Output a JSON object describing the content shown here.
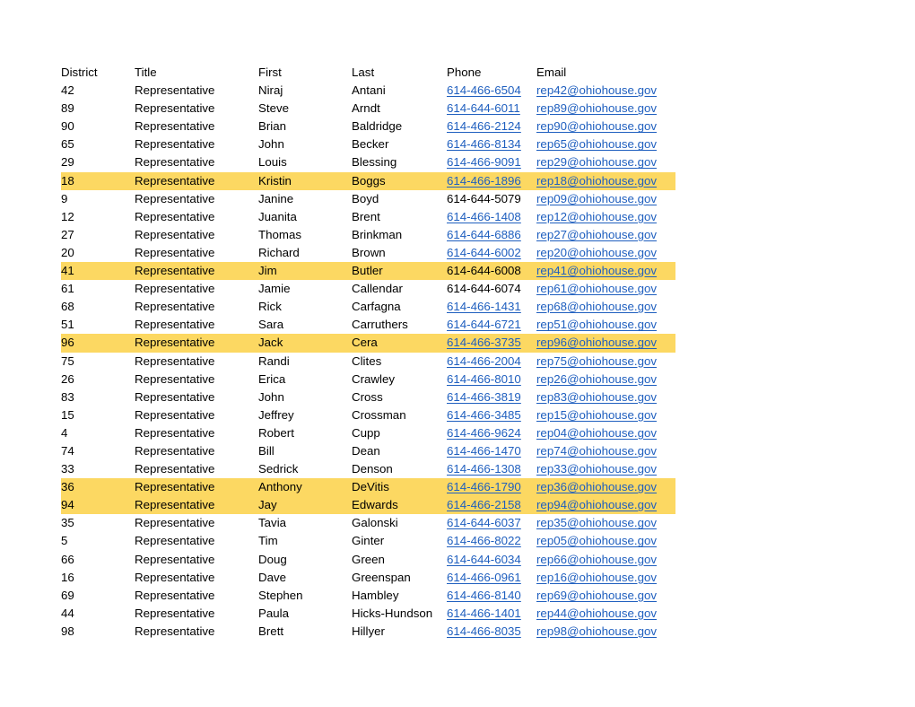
{
  "sheet": {
    "columns": [
      {
        "key": "district",
        "label": "District"
      },
      {
        "key": "title",
        "label": "Title"
      },
      {
        "key": "first",
        "label": "First"
      },
      {
        "key": "last",
        "label": "Last"
      },
      {
        "key": "phone",
        "label": "Phone"
      },
      {
        "key": "email",
        "label": "Email"
      }
    ],
    "highlight_color": "#FCD862",
    "link_color": "#1F5FBF",
    "text_color": "#000000",
    "rows": [
      {
        "district": "42",
        "title": "Representative",
        "first": "Niraj",
        "last": "Antani",
        "phone": "614-466-6504",
        "phone_link": true,
        "email": "rep42@ohiohouse.gov",
        "email_link": true,
        "highlighted": false
      },
      {
        "district": "89",
        "title": "Representative",
        "first": "Steve",
        "last": "Arndt",
        "phone": "614-644-6011",
        "phone_link": true,
        "email": "rep89@ohiohouse.gov",
        "email_link": true,
        "highlighted": false
      },
      {
        "district": "90",
        "title": "Representative",
        "first": "Brian",
        "last": "Baldridge",
        "phone": "614-466-2124",
        "phone_link": true,
        "email": "rep90@ohiohouse.gov",
        "email_link": true,
        "highlighted": false
      },
      {
        "district": "65",
        "title": "Representative",
        "first": "John",
        "last": "Becker",
        "phone": "614-466-8134",
        "phone_link": true,
        "email": "rep65@ohiohouse.gov",
        "email_link": true,
        "highlighted": false
      },
      {
        "district": "29",
        "title": "Representative",
        "first": "Louis",
        "last": "Blessing",
        "phone": "614-466-9091",
        "phone_link": true,
        "email": "rep29@ohiohouse.gov",
        "email_link": true,
        "highlighted": false
      },
      {
        "district": "18",
        "title": "Representative",
        "first": "Kristin",
        "last": "Boggs",
        "phone": "614-466-1896",
        "phone_link": true,
        "email": "rep18@ohiohouse.gov",
        "email_link": true,
        "highlighted": true
      },
      {
        "district": "9",
        "title": "Representative",
        "first": "Janine",
        "last": "Boyd",
        "phone": "614-644-5079",
        "phone_link": false,
        "email": "rep09@ohiohouse.gov",
        "email_link": true,
        "highlighted": false
      },
      {
        "district": "12",
        "title": "Representative",
        "first": "Juanita",
        "last": "Brent",
        "phone": "614-466-1408",
        "phone_link": true,
        "email": "rep12@ohiohouse.gov",
        "email_link": true,
        "highlighted": false
      },
      {
        "district": "27",
        "title": "Representative",
        "first": "Thomas",
        "last": "Brinkman",
        "phone": "614-644-6886",
        "phone_link": true,
        "email": "rep27@ohiohouse.gov",
        "email_link": true,
        "highlighted": false
      },
      {
        "district": "20",
        "title": "Representative",
        "first": "Richard",
        "last": "Brown",
        "phone": "614-644-6002",
        "phone_link": true,
        "email": "rep20@ohiohouse.gov",
        "email_link": true,
        "highlighted": false
      },
      {
        "district": "41",
        "title": "Representative",
        "first": "Jim",
        "last": "Butler",
        "phone": "614-644-6008",
        "phone_link": false,
        "email": "rep41@ohiohouse.gov",
        "email_link": true,
        "highlighted": true
      },
      {
        "district": "61",
        "title": "Representative",
        "first": "Jamie",
        "last": "Callendar",
        "phone": "614-644-6074",
        "phone_link": false,
        "email": "rep61@ohiohouse.gov",
        "email_link": true,
        "highlighted": false
      },
      {
        "district": "68",
        "title": "Representative",
        "first": "Rick",
        "last": "Carfagna",
        "phone": "614-466-1431",
        "phone_link": true,
        "email": "rep68@ohiohouse.gov",
        "email_link": true,
        "highlighted": false
      },
      {
        "district": "51",
        "title": "Representative",
        "first": "Sara",
        "last": "Carruthers",
        "phone": "614-644-6721",
        "phone_link": true,
        "email": "rep51@ohiohouse.gov",
        "email_link": true,
        "highlighted": false
      },
      {
        "district": "96",
        "title": "Representative",
        "first": "Jack",
        "last": "Cera",
        "phone": "614-466-3735",
        "phone_link": true,
        "email": "rep96@ohiohouse.gov",
        "email_link": true,
        "highlighted": true
      },
      {
        "district": "75",
        "title": "Representative",
        "first": "Randi",
        "last": "Clites",
        "phone": "614-466-2004",
        "phone_link": true,
        "email": "rep75@ohiohouse.gov",
        "email_link": true,
        "highlighted": false
      },
      {
        "district": "26",
        "title": "Representative",
        "first": "Erica",
        "last": "Crawley",
        "phone": "614-466-8010",
        "phone_link": true,
        "email": "rep26@ohiohouse.gov",
        "email_link": true,
        "highlighted": false
      },
      {
        "district": "83",
        "title": "Representative",
        "first": "John",
        "last": "Cross",
        "phone": "614-466-3819",
        "phone_link": true,
        "email": "rep83@ohiohouse.gov",
        "email_link": true,
        "highlighted": false
      },
      {
        "district": "15",
        "title": "Representative",
        "first": "Jeffrey",
        "last": "Crossman",
        "phone": "614-466-3485",
        "phone_link": true,
        "email": "rep15@ohiohouse.gov",
        "email_link": true,
        "highlighted": false
      },
      {
        "district": "4",
        "title": "Representative",
        "first": "Robert",
        "last": "Cupp",
        "phone": "614-466-9624",
        "phone_link": true,
        "email": "rep04@ohiohouse.gov",
        "email_link": true,
        "highlighted": false
      },
      {
        "district": "74",
        "title": "Representative",
        "first": "Bill",
        "last": "Dean",
        "phone": "614-466-1470",
        "phone_link": true,
        "email": "rep74@ohiohouse.gov",
        "email_link": true,
        "highlighted": false
      },
      {
        "district": "33",
        "title": "Representative",
        "first": "Sedrick",
        "last": "Denson",
        "phone": "614-466-1308",
        "phone_link": true,
        "email": "rep33@ohiohouse.gov",
        "email_link": true,
        "highlighted": false
      },
      {
        "district": "36",
        "title": "Representative",
        "first": "Anthony",
        "last": "DeVitis",
        "phone": "614-466-1790",
        "phone_link": true,
        "email": "rep36@ohiohouse.gov",
        "email_link": true,
        "highlighted": true
      },
      {
        "district": "94",
        "title": "Representative",
        "first": "Jay",
        "last": "Edwards",
        "phone": "614-466-2158",
        "phone_link": true,
        "email": "rep94@ohiohouse.gov",
        "email_link": true,
        "highlighted": true
      },
      {
        "district": "35",
        "title": "Representative",
        "first": "Tavia",
        "last": "Galonski",
        "phone": "614-644-6037",
        "phone_link": true,
        "email": "rep35@ohiohouse.gov",
        "email_link": true,
        "highlighted": false
      },
      {
        "district": "5",
        "title": "Representative",
        "first": "Tim",
        "last": "Ginter",
        "phone": "614-466-8022",
        "phone_link": true,
        "email": "rep05@ohiohouse.gov",
        "email_link": true,
        "highlighted": false
      },
      {
        "district": "66",
        "title": "Representative",
        "first": "Doug",
        "last": "Green",
        "phone": "614-644-6034",
        "phone_link": true,
        "email": "rep66@ohiohouse.gov",
        "email_link": true,
        "highlighted": false
      },
      {
        "district": "16",
        "title": "Representative",
        "first": "Dave",
        "last": "Greenspan",
        "phone": "614-466-0961",
        "phone_link": true,
        "email": "rep16@ohiohouse.gov",
        "email_link": true,
        "highlighted": false
      },
      {
        "district": "69",
        "title": "Representative",
        "first": "Stephen",
        "last": "Hambley",
        "phone": "614-466-8140",
        "phone_link": true,
        "email": "rep69@ohiohouse.gov",
        "email_link": true,
        "highlighted": false
      },
      {
        "district": "44",
        "title": "Representative",
        "first": "Paula",
        "last": "Hicks-Hundson",
        "phone": "614-466-1401",
        "phone_link": true,
        "email": "rep44@ohiohouse.gov",
        "email_link": true,
        "highlighted": false
      },
      {
        "district": "98",
        "title": "Representative",
        "first": "Brett",
        "last": "Hillyer",
        "phone": "614-466-8035",
        "phone_link": true,
        "email": "rep98@ohiohouse.gov",
        "email_link": true,
        "highlighted": false
      }
    ]
  }
}
